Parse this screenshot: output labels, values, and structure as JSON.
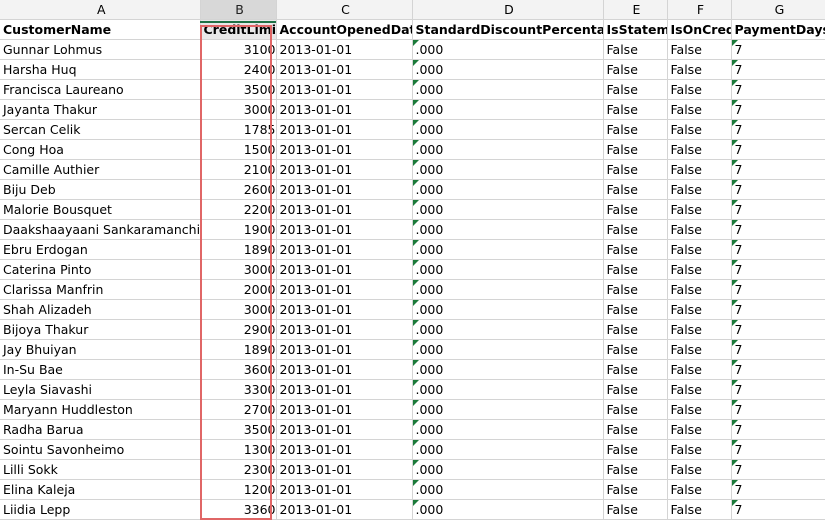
{
  "columns": [
    "A",
    "B",
    "C",
    "D",
    "E",
    "F",
    "G"
  ],
  "selected_column": "B",
  "headers": [
    "CustomerName",
    "CreditLimit",
    "AccountOpenedDate",
    "StandardDiscountPercentage",
    "IsStateme",
    "IsOnCredi",
    "PaymentDays"
  ],
  "rows": [
    [
      "Gunnar Lohmus",
      "3100",
      "2013-01-01",
      ".000",
      "False",
      "False",
      "7"
    ],
    [
      "Harsha Huq",
      "2400",
      "2013-01-01",
      ".000",
      "False",
      "False",
      "7"
    ],
    [
      "Francisca Laureano",
      "3500",
      "2013-01-01",
      ".000",
      "False",
      "False",
      "7"
    ],
    [
      "Jayanta Thakur",
      "3000",
      "2013-01-01",
      ".000",
      "False",
      "False",
      "7"
    ],
    [
      "Sercan Celik",
      "1785",
      "2013-01-01",
      ".000",
      "False",
      "False",
      "7"
    ],
    [
      "Cong Hoa",
      "1500",
      "2013-01-01",
      ".000",
      "False",
      "False",
      "7"
    ],
    [
      "Camille Authier",
      "2100",
      "2013-01-01",
      ".000",
      "False",
      "False",
      "7"
    ],
    [
      "Biju Deb",
      "2600",
      "2013-01-01",
      ".000",
      "False",
      "False",
      "7"
    ],
    [
      "Malorie Bousquet",
      "2200",
      "2013-01-01",
      ".000",
      "False",
      "False",
      "7"
    ],
    [
      "Daakshaayaani Sankaramanchi",
      "1900",
      "2013-01-01",
      ".000",
      "False",
      "False",
      "7"
    ],
    [
      "Ebru Erdogan",
      "1890",
      "2013-01-01",
      ".000",
      "False",
      "False",
      "7"
    ],
    [
      "Caterina Pinto",
      "3000",
      "2013-01-01",
      ".000",
      "False",
      "False",
      "7"
    ],
    [
      "Clarissa Manfrin",
      "2000",
      "2013-01-01",
      ".000",
      "False",
      "False",
      "7"
    ],
    [
      "Shah Alizadeh",
      "3000",
      "2013-01-01",
      ".000",
      "False",
      "False",
      "7"
    ],
    [
      "Bijoya Thakur",
      "2900",
      "2013-01-01",
      ".000",
      "False",
      "False",
      "7"
    ],
    [
      "Jay Bhuiyan",
      "1890",
      "2013-01-01",
      ".000",
      "False",
      "False",
      "7"
    ],
    [
      "In-Su Bae",
      "3600",
      "2013-01-01",
      ".000",
      "False",
      "False",
      "7"
    ],
    [
      "Leyla Siavashi",
      "3300",
      "2013-01-01",
      ".000",
      "False",
      "False",
      "7"
    ],
    [
      "Maryann Huddleston",
      "2700",
      "2013-01-01",
      ".000",
      "False",
      "False",
      "7"
    ],
    [
      "Radha Barua",
      "3500",
      "2013-01-01",
      ".000",
      "False",
      "False",
      "7"
    ],
    [
      "Sointu Savonheimo",
      "1300",
      "2013-01-01",
      ".000",
      "False",
      "False",
      "7"
    ],
    [
      "Lilli Sokk",
      "2300",
      "2013-01-01",
      ".000",
      "False",
      "False",
      "7"
    ],
    [
      "Elina Kaleja",
      "1200",
      "2013-01-01",
      ".000",
      "False",
      "False",
      "7"
    ],
    [
      "Liidia Lepp",
      "3360",
      "2013-01-01",
      ".000",
      "False",
      "False",
      "7"
    ]
  ],
  "colors": {
    "highlight_border": "#e06666",
    "error_indicator": "#1b7a3a",
    "gridline": "#d4d4d4"
  }
}
